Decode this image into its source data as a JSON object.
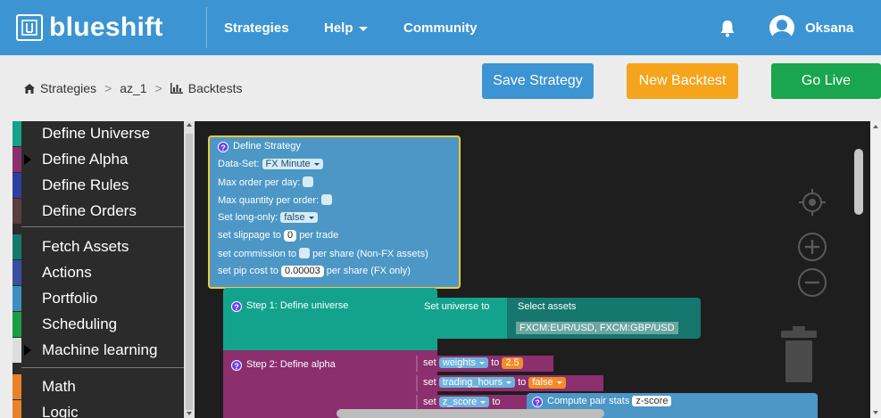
{
  "nav": {
    "brand": "blueshift",
    "links": [
      "Strategies",
      "Help",
      "Community"
    ],
    "user": "Oksana",
    "colors": {
      "bar": "#3c94d2"
    }
  },
  "breadcrumb": {
    "items": [
      "Strategies",
      "az_1",
      "Backtests"
    ],
    "separator": ">"
  },
  "actions": {
    "save": "Save Strategy",
    "new_backtest": "New Backtest",
    "go_live": "Go Live"
  },
  "sidebar": {
    "items": [
      {
        "label": "Define Universe",
        "color": "#13a38c",
        "arrow": false
      },
      {
        "label": "Define Alpha",
        "color": "#8b2f6e",
        "arrow": true
      },
      {
        "label": "Define Rules",
        "color": "#2d3fa0",
        "arrow": false
      },
      {
        "label": "Define Orders",
        "color": "#5a3e3e",
        "arrow": false
      },
      {
        "label": "Fetch Assets",
        "color": "#147a6e",
        "arrow": false
      },
      {
        "label": "Actions",
        "color": "#3a4fa0",
        "arrow": false
      },
      {
        "label": "Portfolio",
        "color": "#3c8fc0",
        "arrow": false
      },
      {
        "label": "Scheduling",
        "color": "#1a9e44",
        "arrow": false
      },
      {
        "label": "Machine learning",
        "color": "#dddddd",
        "arrow": true
      },
      {
        "label": "Math",
        "color": "#e8822a",
        "arrow": false
      },
      {
        "label": "Logic",
        "color": "#e8822a",
        "arrow": false
      }
    ]
  },
  "define": {
    "title": "Define Strategy",
    "dataset_label": "Data-Set:",
    "dataset_value": "FX Minute",
    "max_order": "Max order per day:",
    "max_qty": "Max quantity per order:",
    "long_only_label": "Set long-only:",
    "long_only_value": "false",
    "slippage_pre": "set slippage to",
    "slippage_value": "0",
    "slippage_post": "per trade",
    "commission_pre": "set commission to",
    "commission_post": "per share (Non-FX assets)",
    "pip_pre": "set pip cost to",
    "pip_value": "0.00003",
    "pip_post": "per share (FX only)"
  },
  "step1": {
    "title": "Step 1: Define universe",
    "set_label": "Set universe to",
    "select_label": "Select assets",
    "assets": "FXCM:EUR/USD, FXCM:GBP/USD"
  },
  "step2": {
    "title": "Step 2: Define alpha",
    "set": "set",
    "to": "to",
    "rows": [
      {
        "var": "weights",
        "value": "2.5"
      },
      {
        "var": "trading_hours",
        "value": "false"
      },
      {
        "var": "z_score",
        "value": ""
      }
    ],
    "pair_stats": "Compute pair stats",
    "pair_stats_value": "z-score"
  }
}
